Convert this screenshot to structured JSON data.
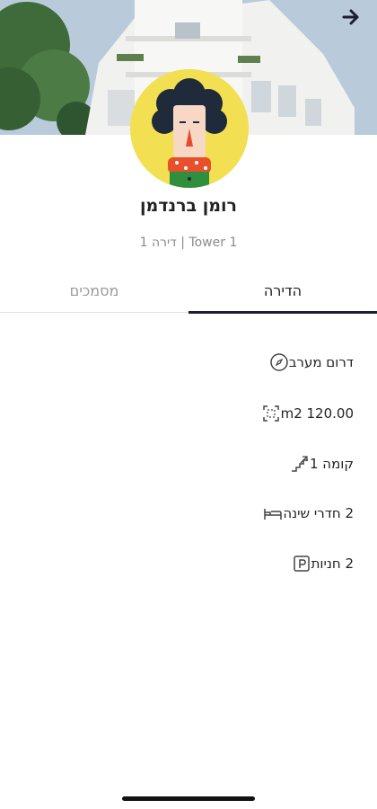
{
  "header": {
    "back_icon": "arrow-right-icon",
    "hero_image": "building-photo"
  },
  "profile": {
    "name": "רומן ברנדמן",
    "subtitle": "Tower 1 | דירה 1",
    "avatar_icon": "avatar-illustration"
  },
  "tabs": [
    {
      "label": "הדירה",
      "active": true
    },
    {
      "label": "מסמכים",
      "active": false
    }
  ],
  "details": [
    {
      "icon": "compass-icon",
      "text": "דרום מערב"
    },
    {
      "icon": "area-icon",
      "text": "m2 120.00"
    },
    {
      "icon": "stairs-icon",
      "text": "קומה 1"
    },
    {
      "icon": "bed-icon",
      "text": "2 חדרי שינה"
    },
    {
      "icon": "parking-icon",
      "text": "2 חניות"
    }
  ],
  "colors": {
    "accent": "#1b1f33",
    "avatar_bg": "#f3df52"
  }
}
